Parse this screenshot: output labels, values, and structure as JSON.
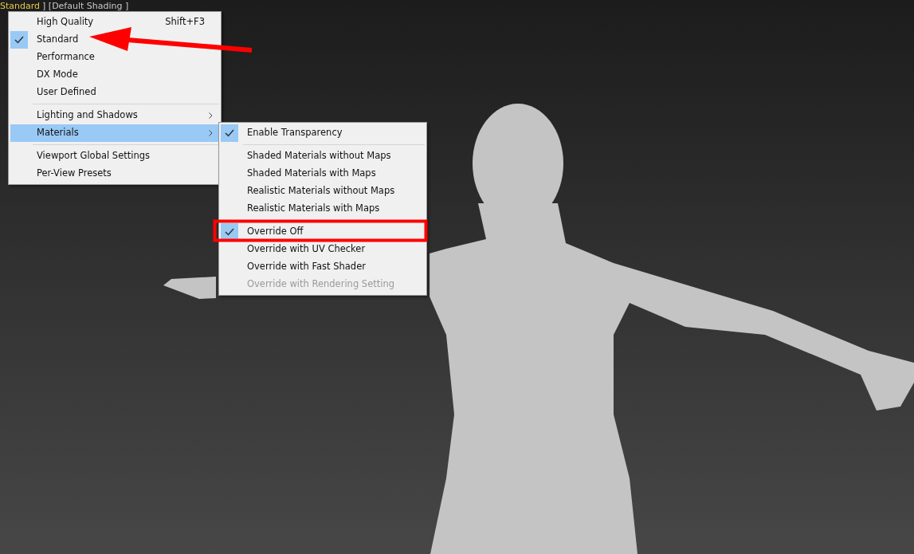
{
  "viewport_label": [
    {
      "text": "Standard",
      "highlight": true
    },
    {
      "text": "] [Default Shading ]",
      "highlight": false
    }
  ],
  "menu": [
    {
      "kind": "item",
      "label": "High Quality",
      "shortcut": "Shift+F3",
      "checked": false,
      "highlighted": false,
      "disabled": false
    },
    {
      "kind": "item",
      "label": "Standard",
      "checked": true,
      "highlighted": false,
      "disabled": false
    },
    {
      "kind": "item",
      "label": "Performance",
      "checked": false,
      "highlighted": false,
      "disabled": false
    },
    {
      "kind": "item",
      "label": "DX Mode",
      "checked": false,
      "highlighted": false,
      "disabled": false
    },
    {
      "kind": "item",
      "label": "User Defined",
      "checked": false,
      "highlighted": false,
      "disabled": false
    },
    {
      "kind": "separator"
    },
    {
      "kind": "submenu",
      "label": "Lighting and Shadows",
      "checked": false,
      "highlighted": false,
      "disabled": false
    },
    {
      "kind": "submenu",
      "label": "Materials",
      "checked": false,
      "highlighted": true,
      "disabled": false
    },
    {
      "kind": "separator"
    },
    {
      "kind": "item",
      "label": "Viewport Global Settings",
      "checked": false,
      "highlighted": false,
      "disabled": false
    },
    {
      "kind": "item",
      "label": "Per-View Presets",
      "checked": false,
      "highlighted": false,
      "disabled": false
    }
  ],
  "submenu": [
    {
      "kind": "item",
      "label": "Enable Transparency",
      "checked": true,
      "highlighted": false,
      "disabled": false
    },
    {
      "kind": "separator"
    },
    {
      "kind": "item",
      "label": "Shaded Materials without Maps",
      "checked": false,
      "highlighted": false,
      "disabled": false
    },
    {
      "kind": "item",
      "label": "Shaded Materials with Maps",
      "checked": false,
      "highlighted": false,
      "disabled": false
    },
    {
      "kind": "item",
      "label": "Realistic Materials without Maps",
      "checked": false,
      "highlighted": false,
      "disabled": false
    },
    {
      "kind": "item",
      "label": "Realistic Materials with Maps",
      "checked": false,
      "highlighted": false,
      "disabled": false
    },
    {
      "kind": "separator"
    },
    {
      "kind": "item",
      "label": "Override Off",
      "checked": true,
      "highlighted": false,
      "disabled": false
    },
    {
      "kind": "item",
      "label": "Override with UV Checker",
      "checked": false,
      "highlighted": false,
      "disabled": false
    },
    {
      "kind": "item",
      "label": "Override with Fast Shader",
      "checked": false,
      "highlighted": false,
      "disabled": false
    },
    {
      "kind": "item",
      "label": "Override with Rendering Setting",
      "checked": false,
      "highlighted": false,
      "disabled": true
    }
  ]
}
